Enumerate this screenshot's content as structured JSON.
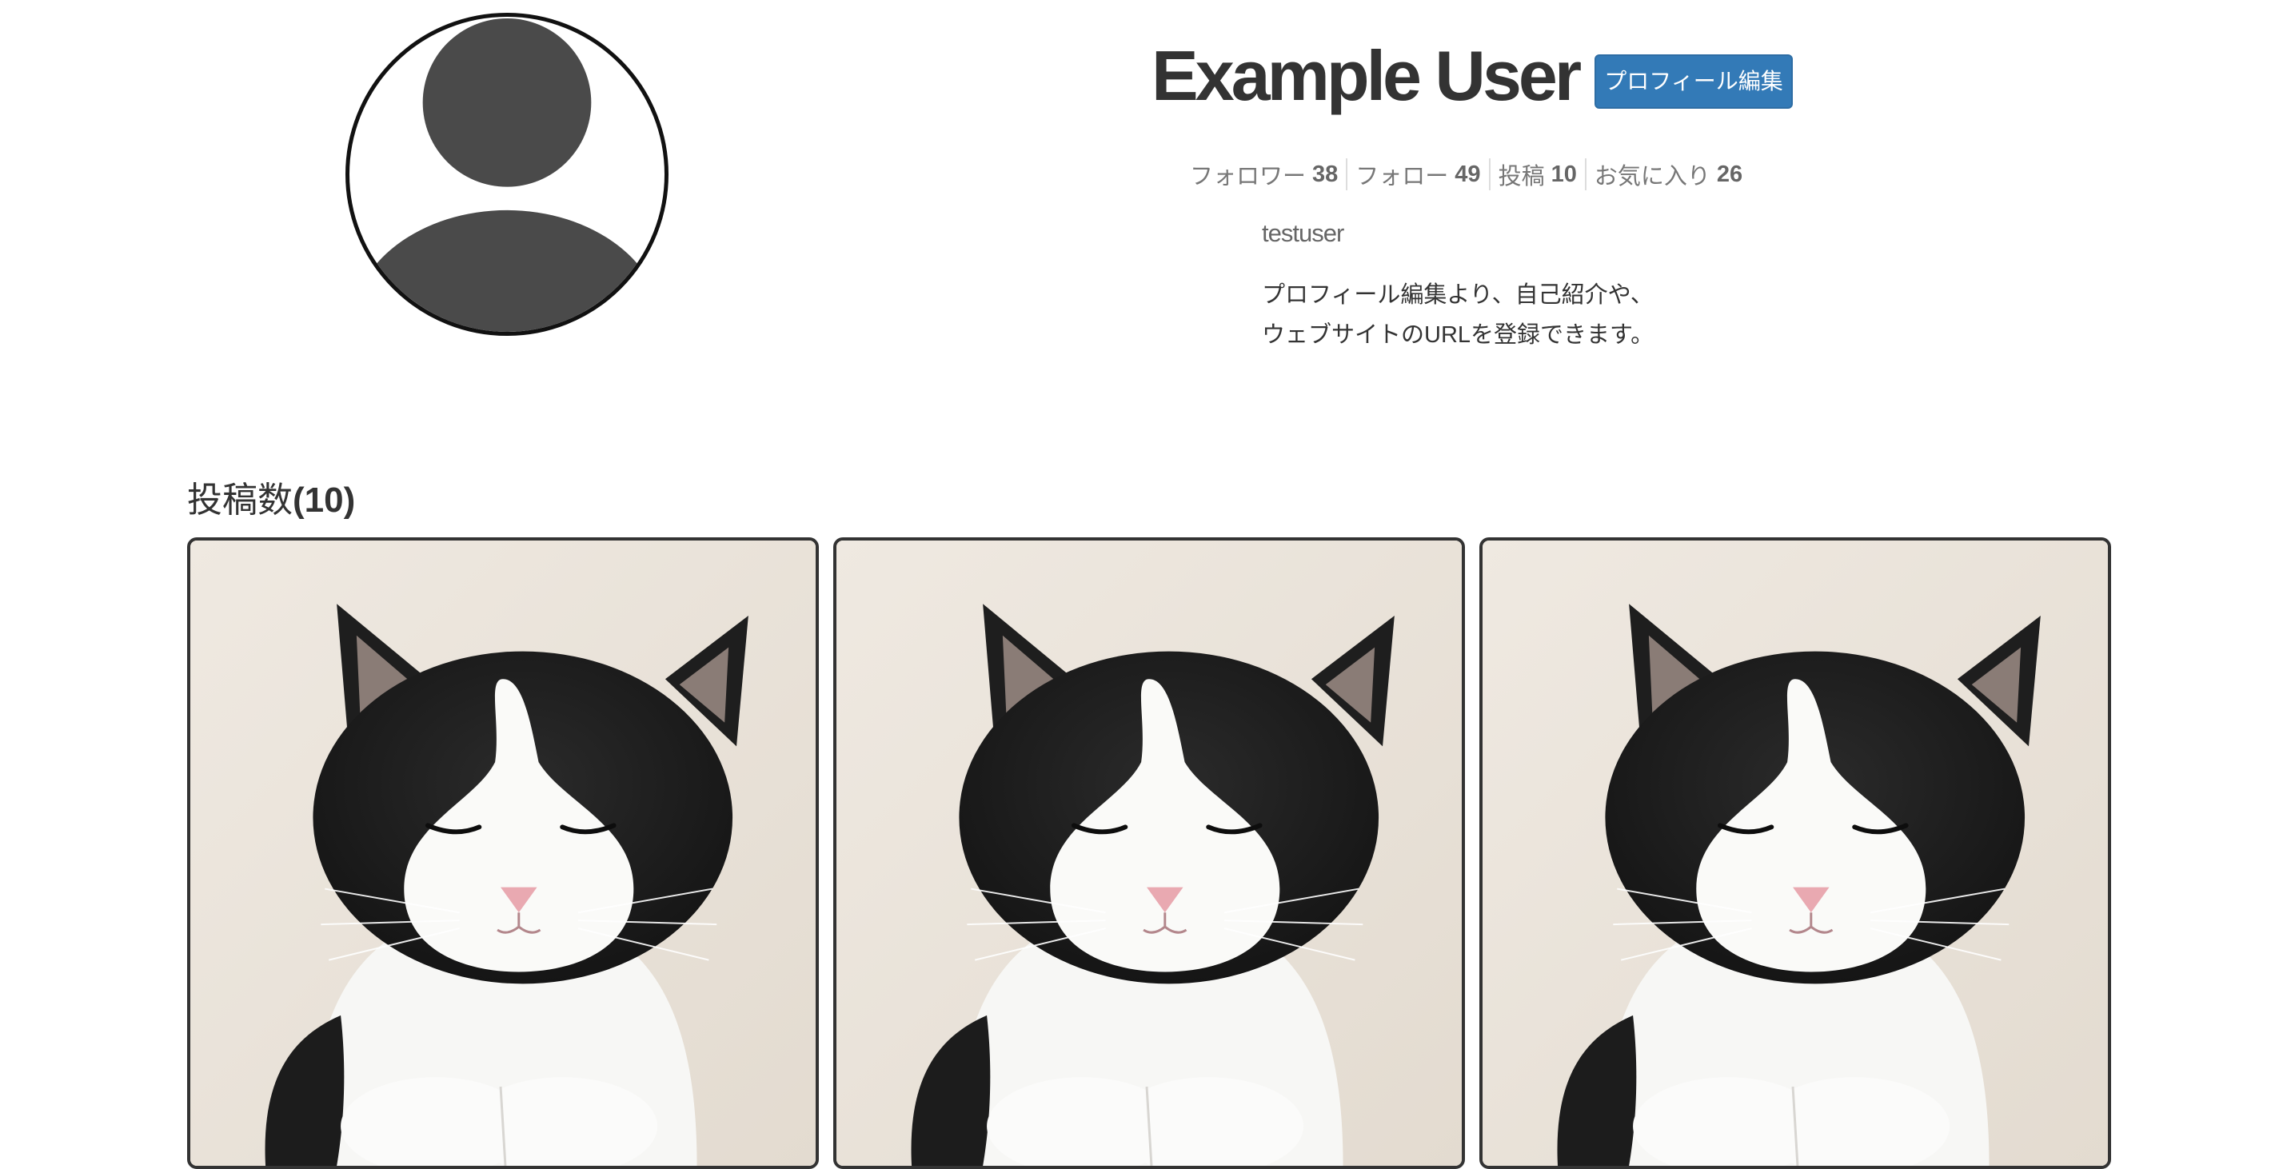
{
  "profile": {
    "display_name": "Example User",
    "edit_button_label": "プロフィール編集",
    "handle": "testuser",
    "bio_lines": [
      "プロフィール編集より、自己紹介や、",
      "ウェブサイトのURLを登録できます。"
    ],
    "avatar_icon": "default-user-icon"
  },
  "stats": [
    {
      "label": "フォロワー",
      "count": "38"
    },
    {
      "label": "フォロー",
      "count": "49"
    },
    {
      "label": "投稿",
      "count": "10"
    },
    {
      "label": "お気に入り",
      "count": "26"
    }
  ],
  "posts": {
    "heading_label": "投稿数",
    "heading_count": "(10)",
    "items": [
      {
        "image": "black-and-white-cat-photo"
      },
      {
        "image": "black-and-white-cat-photo"
      },
      {
        "image": "black-and-white-cat-photo"
      }
    ]
  },
  "colors": {
    "primary_button": "#337ab7",
    "text": "#333333",
    "muted_text": "#777777",
    "avatar_fill": "#4a4a4a"
  }
}
